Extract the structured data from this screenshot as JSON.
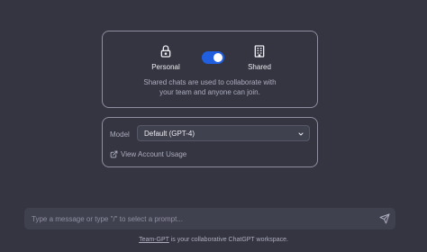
{
  "mode": {
    "personal_label": "Personal",
    "shared_label": "Shared",
    "toggle_state": "shared",
    "description_line1": "Shared chats are used to collaborate with",
    "description_line2": "your team and anyone can join.",
    "icons": {
      "personal": "lock-icon",
      "shared": "building-icon"
    }
  },
  "model": {
    "label": "Model",
    "selected": "Default (GPT-4)",
    "account_link": "View Account Usage",
    "icons": {
      "select": "chevron-down-icon",
      "account_link": "external-link-icon"
    }
  },
  "composer": {
    "placeholder": "Type a message or type \"/\" to select a prompt...",
    "send_icon": "send-icon"
  },
  "footer": {
    "link_text": "Team-GPT",
    "text": " is your collaborative ChatGPT workspace."
  },
  "colors": {
    "background": "#343541",
    "toggle_accent": "#1f5fe0",
    "input_background": "#40414f",
    "border": "#8e8ea0"
  }
}
